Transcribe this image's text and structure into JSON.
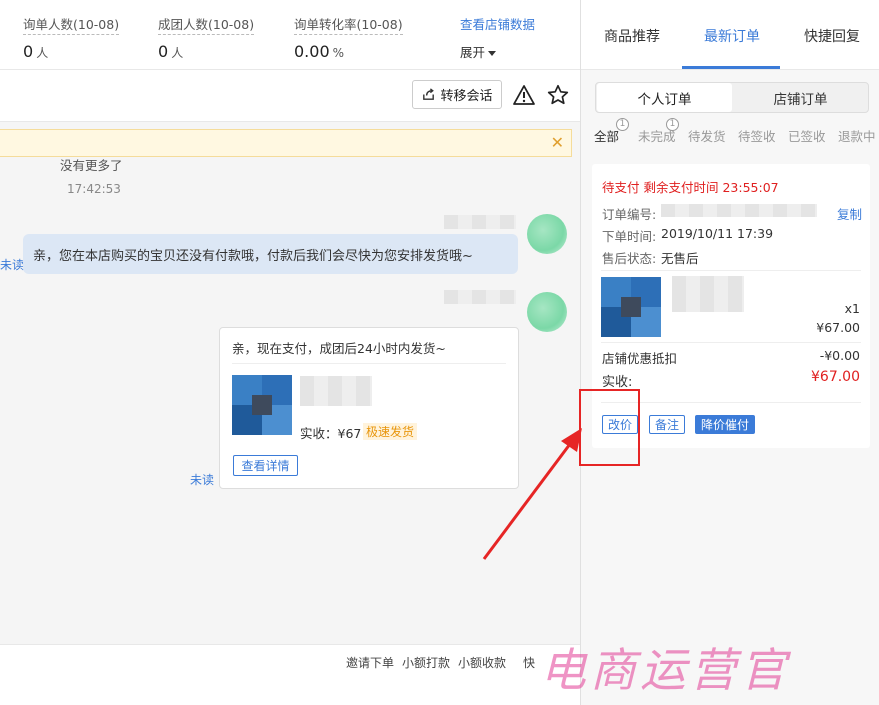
{
  "stats": [
    {
      "label": "询单人数(10-08)",
      "value": "0",
      "unit": "人"
    },
    {
      "label": "成团人数(10-08)",
      "value": "0",
      "unit": "人"
    },
    {
      "label": "询单转化率(10-08)",
      "value": "0.00",
      "unit": "%"
    }
  ],
  "stats_link": "查看店铺数据",
  "expand_label": "展开",
  "toolbar": {
    "transfer_label": "转移会话"
  },
  "chat": {
    "no_more": "没有更多了",
    "time": "17:42:53",
    "message": "亲，您在本店购买的宝贝还没有付款哦，付款后我们会尽快为您安排发货哦~",
    "unread_label": "未读",
    "card": {
      "title": "亲，现在支付，成团后24小时内发货~",
      "actual_label": "实收：¥67",
      "fast_tag": "极速发货",
      "detail_button": "查看详情"
    }
  },
  "bottom_links": [
    "邀请下单",
    "小额打款",
    "小额收款",
    "快"
  ],
  "right_tabs": [
    "商品推荐",
    "最新订单",
    "快捷回复"
  ],
  "order_segments": [
    "个人订单",
    "店铺订单"
  ],
  "filter_tabs": [
    {
      "label": "全部",
      "badge": "1"
    },
    {
      "label": "未完成",
      "badge": "1"
    },
    {
      "label": "待发货",
      "badge": ""
    },
    {
      "label": "待签收",
      "badge": ""
    },
    {
      "label": "已签收",
      "badge": ""
    },
    {
      "label": "退款中",
      "badge": ""
    }
  ],
  "order": {
    "status": "待支付",
    "countdown": "剩余支付时间 23:55:07",
    "order_no_label": "订单编号:",
    "copy_label": "复制",
    "order_time_label": "下单时间:",
    "order_time": "2019/10/11 17:39",
    "after_sale_label": "售后状态:",
    "after_sale": "无售后",
    "qty": "x1",
    "price": "¥67.00",
    "discount_label": "店铺优惠抵扣",
    "discount": "-¥0.00",
    "actual_label": "实收:",
    "actual": "¥67.00",
    "buttons": [
      "改价",
      "备注",
      "降价催付"
    ]
  },
  "watermark": "电商运营官",
  "colors": {
    "accent": "#3b7bd8",
    "alert": "#e02020",
    "highlight_box": "#e62525"
  }
}
